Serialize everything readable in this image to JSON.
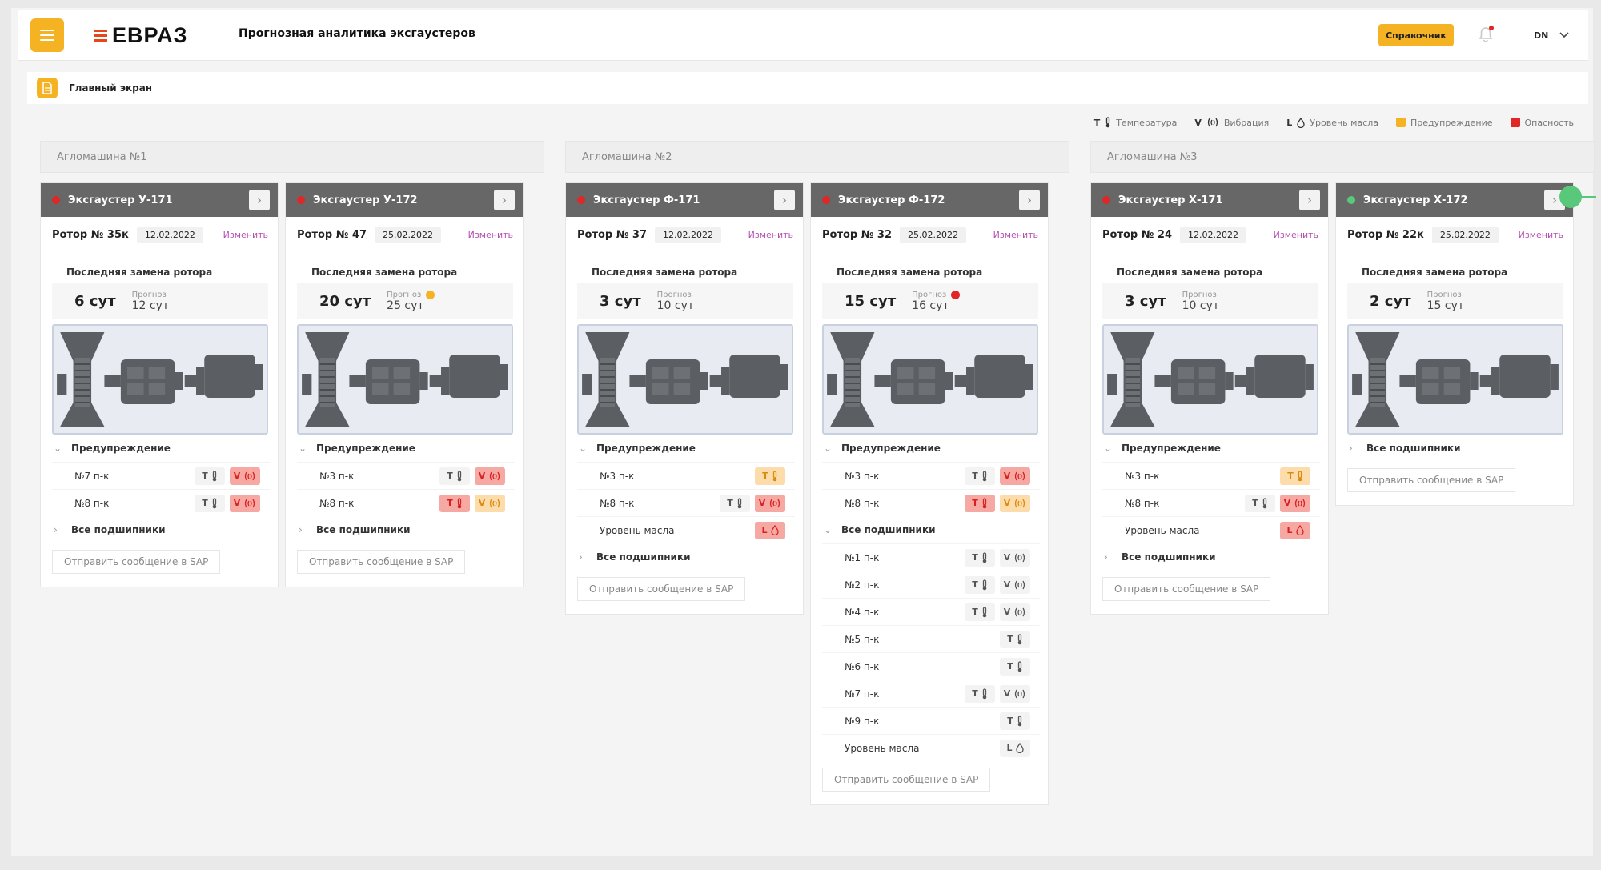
{
  "header": {
    "logo_text": "ЕВРАЗ",
    "app_title": "Прогнозная аналитика эксгаустеров",
    "reference_button": "Справочник",
    "user_initials": "DN"
  },
  "breadcrumb": {
    "label": "Главный экран"
  },
  "legend": [
    {
      "symbol": "T",
      "label": "Температура",
      "kind": "temperature"
    },
    {
      "symbol": "V",
      "label": "Вибрация",
      "kind": "vibration"
    },
    {
      "symbol": "L",
      "label": "Уровень масла",
      "kind": "oil"
    },
    {
      "label": "Предупреждение",
      "color": "#f5b324",
      "kind": "warning"
    },
    {
      "label": "Опасность",
      "color": "#e02626",
      "kind": "danger"
    }
  ],
  "colors": {
    "accent": "#f5b324",
    "danger": "#e02626",
    "ok": "#5ac87a",
    "link": "#b44fb0"
  },
  "machines": [
    {
      "title": "Агломашина №1",
      "exhausters": [
        {
          "name": "Эксгаустер У-171",
          "status": "danger",
          "rotor": "Ротор № 35к",
          "date": "12.02.2022",
          "change_label": "Изменить",
          "last_replacement_label": "Последняя замена ротора",
          "days": "6 сут",
          "forecast_label": "Прогноз",
          "forecast": "12 сут",
          "forecast_status": "",
          "warning_expanded": true,
          "warning_label": "Предупреждение",
          "warnings": [
            {
              "label": "№7 п-к",
              "badges": [
                {
                  "type": "T",
                  "level": "normal"
                },
                {
                  "type": "V",
                  "level": "danger"
                }
              ]
            },
            {
              "label": "№8 п-к",
              "badges": [
                {
                  "type": "T",
                  "level": "normal"
                },
                {
                  "type": "V",
                  "level": "danger"
                }
              ]
            }
          ],
          "all_expanded": false,
          "all_label": "Все подшипники",
          "all_bearings": [],
          "sap_label": "Отправить сообщение в SAP"
        },
        {
          "name": "Эксгаустер У-172",
          "status": "danger",
          "rotor": "Ротор № 47",
          "date": "25.02.2022",
          "change_label": "Изменить",
          "last_replacement_label": "Последняя замена ротора",
          "days": "20 сут",
          "forecast_label": "Прогноз",
          "forecast": "25 сут",
          "forecast_status": "warning",
          "warning_expanded": true,
          "warning_label": "Предупреждение",
          "warnings": [
            {
              "label": "№3 п-к",
              "badges": [
                {
                  "type": "T",
                  "level": "normal"
                },
                {
                  "type": "V",
                  "level": "danger"
                }
              ]
            },
            {
              "label": "№8 п-к",
              "badges": [
                {
                  "type": "T",
                  "level": "danger"
                },
                {
                  "type": "V",
                  "level": "warning"
                }
              ]
            }
          ],
          "all_expanded": false,
          "all_label": "Все подшипники",
          "all_bearings": [],
          "sap_label": "Отправить сообщение в SAP"
        }
      ]
    },
    {
      "title": "Агломашина №2",
      "exhausters": [
        {
          "name": "Эксгаустер Ф-171",
          "status": "danger",
          "rotor": "Ротор № 37",
          "date": "12.02.2022",
          "change_label": "Изменить",
          "last_replacement_label": "Последняя замена ротора",
          "days": "3 сут",
          "forecast_label": "Прогноз",
          "forecast": "10 сут",
          "forecast_status": "",
          "warning_expanded": true,
          "warning_label": "Предупреждение",
          "warnings": [
            {
              "label": "№3 п-к",
              "badges": [
                {
                  "type": "T",
                  "level": "warning"
                }
              ]
            },
            {
              "label": "№8 п-к",
              "badges": [
                {
                  "type": "T",
                  "level": "normal"
                },
                {
                  "type": "V",
                  "level": "danger"
                }
              ]
            },
            {
              "label": "Уровень масла",
              "badges": [
                {
                  "type": "L",
                  "level": "danger"
                }
              ]
            }
          ],
          "all_expanded": false,
          "all_label": "Все подшипники",
          "all_bearings": [],
          "sap_label": "Отправить сообщение в SAP"
        },
        {
          "name": "Эксгаустер Ф-172",
          "status": "danger",
          "rotor": "Ротор № 32",
          "date": "25.02.2022",
          "change_label": "Изменить",
          "last_replacement_label": "Последняя замена ротора",
          "days": "15 сут",
          "forecast_label": "Прогноз",
          "forecast": "16 сут",
          "forecast_status": "danger",
          "warning_expanded": true,
          "warning_label": "Предупреждение",
          "warnings": [
            {
              "label": "№3 п-к",
              "badges": [
                {
                  "type": "T",
                  "level": "normal"
                },
                {
                  "type": "V",
                  "level": "danger"
                }
              ]
            },
            {
              "label": "№8 п-к",
              "badges": [
                {
                  "type": "T",
                  "level": "danger"
                },
                {
                  "type": "V",
                  "level": "warning"
                }
              ]
            }
          ],
          "all_expanded": true,
          "all_label": "Все подшипники",
          "all_bearings": [
            {
              "label": "№1 п-к",
              "badges": [
                {
                  "type": "T",
                  "level": "normal"
                },
                {
                  "type": "V",
                  "level": "normal"
                }
              ]
            },
            {
              "label": "№2 п-к",
              "badges": [
                {
                  "type": "T",
                  "level": "normal"
                },
                {
                  "type": "V",
                  "level": "normal"
                }
              ]
            },
            {
              "label": "№4 п-к",
              "badges": [
                {
                  "type": "T",
                  "level": "normal"
                },
                {
                  "type": "V",
                  "level": "normal"
                }
              ]
            },
            {
              "label": "№5 п-к",
              "badges": [
                {
                  "type": "T",
                  "level": "normal"
                }
              ]
            },
            {
              "label": "№6 п-к",
              "badges": [
                {
                  "type": "T",
                  "level": "normal"
                }
              ]
            },
            {
              "label": "№7 п-к",
              "badges": [
                {
                  "type": "T",
                  "level": "normal"
                },
                {
                  "type": "V",
                  "level": "normal"
                }
              ]
            },
            {
              "label": "№9 п-к",
              "badges": [
                {
                  "type": "T",
                  "level": "normal"
                }
              ]
            },
            {
              "label": "Уровень масла",
              "badges": [
                {
                  "type": "L",
                  "level": "normal"
                }
              ]
            }
          ],
          "sap_label": "Отправить сообщение в SAP"
        }
      ]
    },
    {
      "title": "Агломашина №3",
      "exhausters": [
        {
          "name": "Эксгаустер Х-171",
          "status": "danger",
          "rotor": "Ротор № 24",
          "date": "12.02.2022",
          "change_label": "Изменить",
          "last_replacement_label": "Последняя замена ротора",
          "days": "3 сут",
          "forecast_label": "Прогноз",
          "forecast": "10 сут",
          "forecast_status": "",
          "warning_expanded": true,
          "warning_label": "Предупреждение",
          "warnings": [
            {
              "label": "№3 п-к",
              "badges": [
                {
                  "type": "T",
                  "level": "warning"
                }
              ]
            },
            {
              "label": "№8 п-к",
              "badges": [
                {
                  "type": "T",
                  "level": "normal"
                },
                {
                  "type": "V",
                  "level": "danger"
                }
              ]
            },
            {
              "label": "Уровень масла",
              "badges": [
                {
                  "type": "L",
                  "level": "danger"
                }
              ]
            }
          ],
          "all_expanded": false,
          "all_label": "Все подшипники",
          "all_bearings": [],
          "sap_label": "Отправить сообщение в SAP"
        },
        {
          "name": "Эксгаустер Х-172",
          "status": "ok",
          "rotor": "Ротор № 22к",
          "date": "25.02.2022",
          "change_label": "Изменить",
          "last_replacement_label": "Последняя замена ротора",
          "days": "2 сут",
          "forecast_label": "Прогноз",
          "forecast": "15 сут",
          "forecast_status": "",
          "warning_expanded": false,
          "warning_label": "",
          "warnings": [],
          "all_expanded": false,
          "all_label": "Все подшипники",
          "all_bearings": [],
          "sap_label": "Отправить сообщение в SAP"
        }
      ]
    }
  ]
}
